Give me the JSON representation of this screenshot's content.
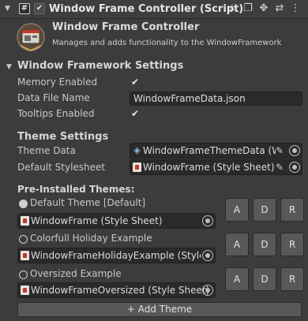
{
  "header": {
    "title": "Window Frame Controller (Script)",
    "fold_glyph": "▼",
    "hash_glyph": "#",
    "check_glyph": "✔",
    "icons": [
      "star-icon",
      "copy-icon",
      "move-icon",
      "sliders-icon",
      "more-icon"
    ],
    "icon_glyphs": [
      "☆",
      "❐",
      "✥",
      "⇄",
      "⋮"
    ]
  },
  "info": {
    "title": "Window Frame Controller",
    "description": "Manages and adds functionality to the WindowFramework"
  },
  "framework_settings": {
    "title": "Window Framework Settings",
    "fold_glyph": "▼",
    "memory_label": "Memory Enabled",
    "memory_value": "✔",
    "data_file_label": "Data File Name",
    "data_file_value": "WindowFrameData.json",
    "tooltips_label": "Tooltips Enabled",
    "tooltips_value": "✔"
  },
  "theme_settings": {
    "title": "Theme Settings",
    "theme_data_label": "Theme Data",
    "theme_data_value": "WindowFrameThemeData (Wind",
    "default_stylesheet_label": "Default Stylesheet",
    "default_stylesheet_value": "WindowFrame (Style Sheet)",
    "pen_glyph": "✎"
  },
  "preinstalled": {
    "title": "Pre-Installed Themes:",
    "themes": [
      {
        "name": "Default Theme [Default]",
        "sheet": "WindowFrame (Style Sheet)",
        "selected": true
      },
      {
        "name": "Colorfull Holiday Example",
        "sheet": "WindowFrameHolidayExample (Style S",
        "selected": false
      },
      {
        "name": "Oversized Example",
        "sheet": "WindowFrameOversized (Style Sheet)",
        "selected": false
      }
    ],
    "button_a": "A",
    "button_d": "D",
    "button_r": "R"
  },
  "add_theme_label": "+ Add Theme"
}
